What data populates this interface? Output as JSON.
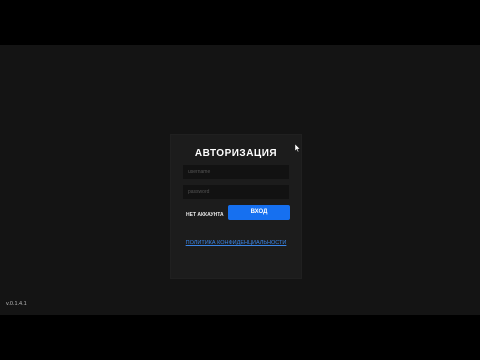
{
  "login": {
    "title": "АВТОРИЗАЦИЯ",
    "username_placeholder": "username",
    "password_placeholder": "password",
    "no_account_label": "НЕТ АККАУНТА",
    "login_button_label": "ВХОД"
  },
  "footer": {
    "privacy_link": "ПОЛИТИКА КОНФИДЕНЦИАЛЬНОСТИ",
    "version": "v.0.1.4.1"
  },
  "colors": {
    "background": "#141414",
    "panel": "#1c1c1c",
    "accent": "#1670f0",
    "link": "#3a86e8"
  },
  "icons": {
    "cursor": "mouse-pointer-icon"
  }
}
